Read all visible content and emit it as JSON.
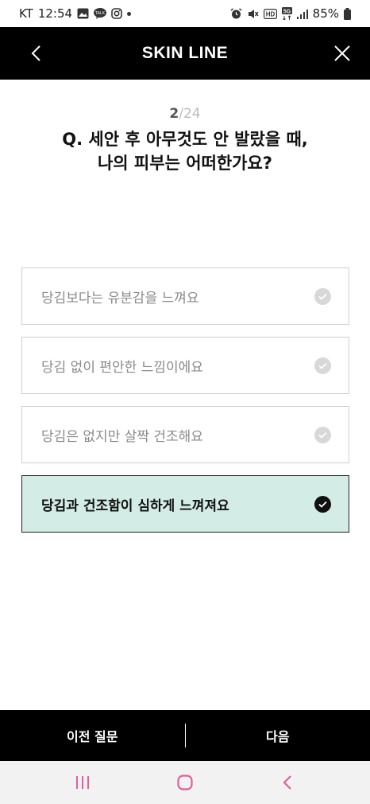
{
  "status_bar": {
    "carrier": "KT",
    "time": "12:54",
    "battery": "85%",
    "icons": [
      "image-icon",
      "talk-icon",
      "instagram-icon",
      "dot-icon",
      "alarm-icon",
      "mute-icon",
      "hd-icon",
      "5g-icon",
      "signal-icon",
      "battery-icon"
    ]
  },
  "header": {
    "title": "SKIN LINE",
    "back_icon": "chevron-left-icon",
    "close_icon": "close-icon"
  },
  "progress": {
    "current": "2",
    "separator": "/",
    "total": "24"
  },
  "question": {
    "line1": "Q. 세안 후 아무것도 안 발랐을 때,",
    "line2": "나의 피부는 어떠한가요?"
  },
  "options": [
    {
      "label": "당김보다는 유분감을 느껴요",
      "selected": false
    },
    {
      "label": "당김 없이 편안한 느낌이에요",
      "selected": false
    },
    {
      "label": "당김은 없지만 살짝 건조해요",
      "selected": false
    },
    {
      "label": "당김과 건조함이 심하게 느껴져요",
      "selected": true
    }
  ],
  "bottom": {
    "prev_label": "이전 질문",
    "next_label": "다음"
  },
  "colors": {
    "header_bg": "#000000",
    "selected_bg": "#d3ece5",
    "nav_icon": "#e0609a"
  },
  "nav_bar": {
    "icons": [
      "recent-apps-icon",
      "home-icon",
      "back-icon"
    ]
  }
}
